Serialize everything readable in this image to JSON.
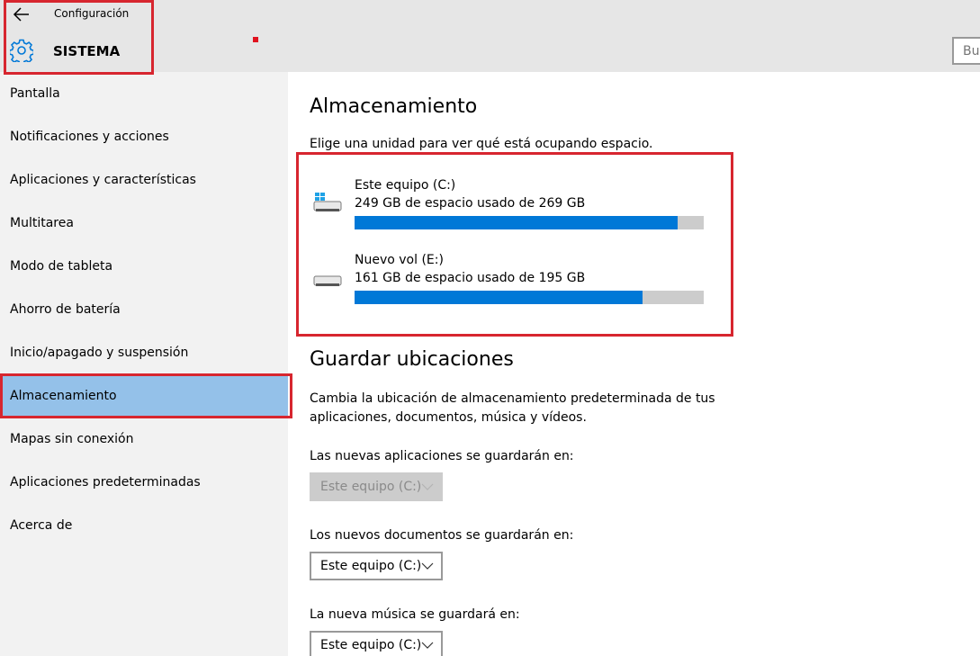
{
  "header": {
    "app_title": "Configuración",
    "section_title": "SISTEMA",
    "search_placeholder": "Bus"
  },
  "icons": {
    "back": "back-arrow-icon",
    "settings": "gear-icon",
    "drive_c": "windows-drive-icon",
    "drive_e": "drive-icon",
    "dropdown": "chevron-down-icon"
  },
  "colors": {
    "accent": "#0078d7",
    "selected": "#94c1e9",
    "highlight_frame": "#d7262f"
  },
  "sidebar": {
    "items": [
      {
        "label": "Pantalla"
      },
      {
        "label": "Notificaciones y acciones"
      },
      {
        "label": "Aplicaciones y características"
      },
      {
        "label": "Multitarea"
      },
      {
        "label": "Modo de tableta"
      },
      {
        "label": "Ahorro de batería"
      },
      {
        "label": "Inicio/apagado y suspensión"
      },
      {
        "label": "Almacenamiento",
        "selected": true
      },
      {
        "label": "Mapas sin conexión"
      },
      {
        "label": "Aplicaciones predeterminadas"
      },
      {
        "label": "Acerca de"
      }
    ]
  },
  "storage": {
    "title": "Almacenamiento",
    "description": "Elige una unidad para ver qué está ocupando espacio.",
    "drives": [
      {
        "name": "Este equipo (C:)",
        "usage": "249 GB de espacio usado de 269 GB",
        "used_fraction": 0.9257
      },
      {
        "name": "Nuevo vol (E:)",
        "usage": "161 GB de espacio usado de 195 GB",
        "used_fraction": 0.8256
      }
    ]
  },
  "save_locations": {
    "title": "Guardar ubicaciones",
    "description_line1": "Cambia la ubicación de almacenamiento predeterminada de tus",
    "description_line2": "aplicaciones, documentos, música y vídeos.",
    "apps_label": "Las nuevas aplicaciones se guardarán en:",
    "apps_value": "Este equipo (C:)",
    "docs_label": "Los nuevos documentos se guardarán en:",
    "docs_value": "Este equipo (C:)",
    "music_label": "La nueva música se guardará en:",
    "music_value": "Este equipo (C:)"
  }
}
